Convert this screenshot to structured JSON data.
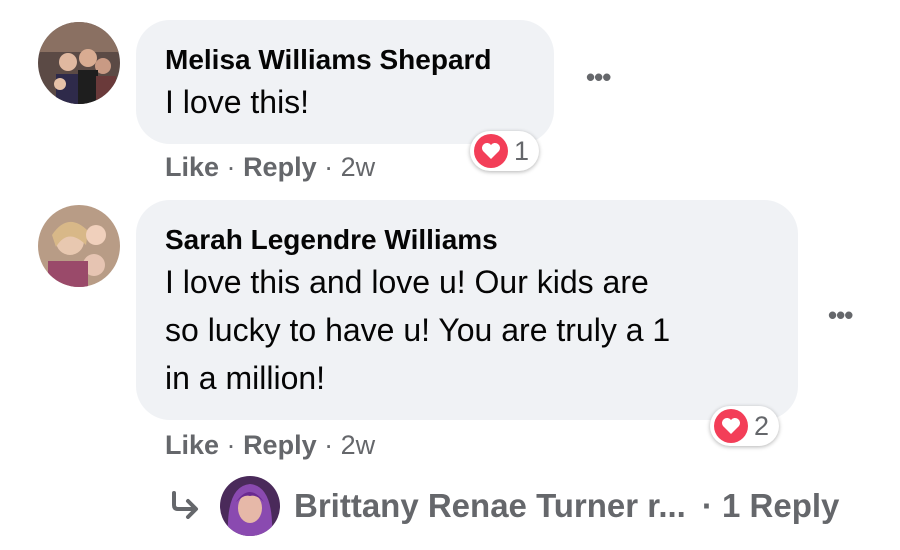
{
  "comments": [
    {
      "author": "Melisa Williams Shepard",
      "text_lines": [
        "I love this!"
      ],
      "reaction_count": "1",
      "like_label": "Like",
      "separator": "·",
      "reply_label": "Reply",
      "time": "2w"
    },
    {
      "author": "Sarah Legendre Williams",
      "text_lines": [
        "I love this and love u! Our kids are",
        "so lucky to have u! You are truly a 1",
        "in a million!"
      ],
      "reaction_count": "2",
      "like_label": "Like",
      "separator": "·",
      "reply_label": "Reply",
      "time": "2w"
    }
  ],
  "reply_thread": {
    "author_truncated": "Brittany Renae Turner r...",
    "replies_label": "· 1 Reply"
  },
  "icons": {
    "more": "more-options-icon",
    "heart": "heart-icon",
    "reply_arrow": "reply-arrow-icon"
  },
  "colors": {
    "bubble": "#f0f2f5",
    "secondary_text": "#65676b",
    "heart": "#f33e58"
  }
}
